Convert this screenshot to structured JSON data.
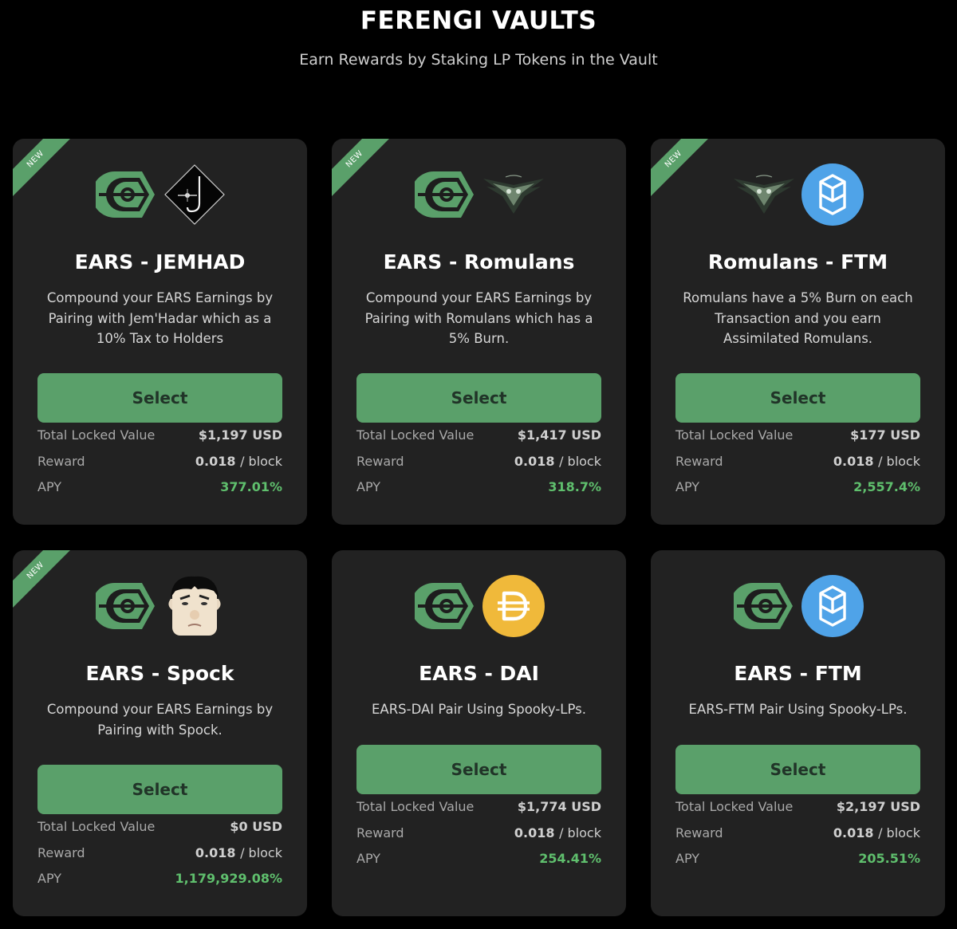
{
  "header": {
    "title": "FERENGI VAULTS",
    "subtitle": "Earn Rewards by Staking LP Tokens in the Vault"
  },
  "colors": {
    "background": "#000000",
    "card": "#222222",
    "accent_green": "#5aa06a",
    "apy_green": "#5fbf6d"
  },
  "labels": {
    "ribbon": "NEW",
    "select": "Select",
    "tvl": "Total Locked Value",
    "reward": "Reward",
    "apy": "APY",
    "reward_unit": "/ block"
  },
  "vaults": [
    {
      "is_new": true,
      "token_icons": [
        "ferengi-ears-icon",
        "jemhadar-icon"
      ],
      "title": "EARS - JEMHAD",
      "description": "Compound your EARS Earnings by Pairing with Jem'Hadar which as a 10% Tax to Holders",
      "tvl": "$1,197 USD",
      "reward": "0.018",
      "apy": "377.01%"
    },
    {
      "is_new": true,
      "token_icons": [
        "ferengi-ears-icon",
        "romulan-warbird-icon"
      ],
      "title": "EARS - Romulans",
      "description": "Compound your EARS Earnings by Pairing with Romulans which has a 5% Burn.",
      "tvl": "$1,417 USD",
      "reward": "0.018",
      "apy": "318.7%"
    },
    {
      "is_new": true,
      "token_icons": [
        "romulan-warbird-icon",
        "fantom-ftm-icon"
      ],
      "title": "Romulans - FTM",
      "description": "Romulans have a 5% Burn on each Transaction and you earn Assimilated Romulans.",
      "tvl": "$177 USD",
      "reward": "0.018",
      "apy": "2,557.4%"
    },
    {
      "is_new": true,
      "token_icons": [
        "ferengi-ears-icon",
        "spock-face-icon"
      ],
      "title": "EARS - Spock",
      "description": "Compound your EARS Earnings by Pairing with Spock.",
      "tvl": "$0 USD",
      "reward": "0.018",
      "apy": "1,179,929.08%"
    },
    {
      "is_new": false,
      "token_icons": [
        "ferengi-ears-icon",
        "dai-icon"
      ],
      "title": "EARS - DAI",
      "description": "EARS-DAI Pair Using Spooky-LPs.",
      "tvl": "$1,774 USD",
      "reward": "0.018",
      "apy": "254.41%"
    },
    {
      "is_new": false,
      "token_icons": [
        "ferengi-ears-icon",
        "fantom-ftm-icon"
      ],
      "title": "EARS - FTM",
      "description": "EARS-FTM Pair Using Spooky-LPs.",
      "tvl": "$2,197 USD",
      "reward": "0.018",
      "apy": "205.51%"
    }
  ]
}
